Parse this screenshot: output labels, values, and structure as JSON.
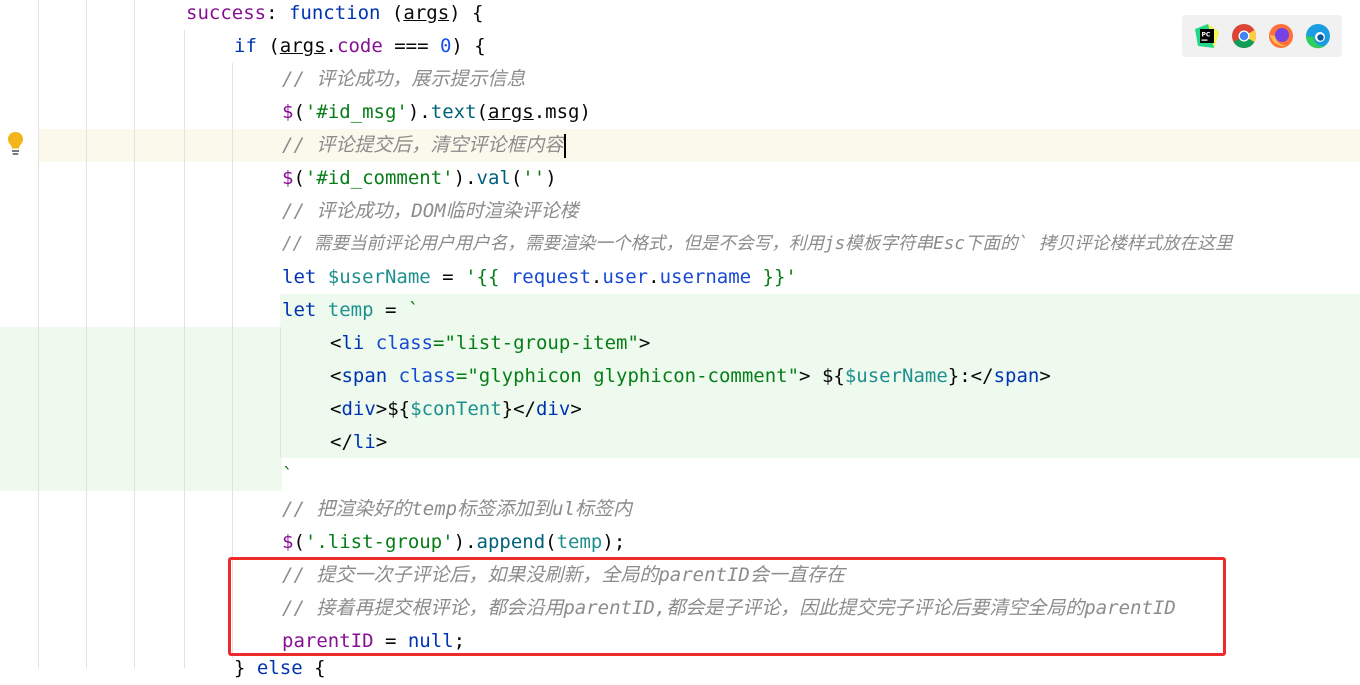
{
  "code": {
    "l1": {
      "a": "success",
      "b": ": ",
      "c": "function",
      "d": " (",
      "e": "args",
      "f": ") {"
    },
    "l2": {
      "a": "if",
      "b": " (",
      "c": "args",
      "d": ".",
      "e": "code",
      "f": " === ",
      "g": "0",
      "h": ") {"
    },
    "l3": "// 评论成功，展示提示信息",
    "l4": {
      "a": "$",
      "b": "(",
      "c": "'#id_msg'",
      "d": ").",
      "e": "text",
      "f": "(",
      "g": "args",
      "h": ".msg)"
    },
    "l5": "// 评论提交后，清空评论框内容",
    "l6": {
      "a": "$",
      "b": "(",
      "c": "'#id_comment'",
      "d": ").",
      "e": "val",
      "f": "(",
      "g": "''",
      "h": ")"
    },
    "l7": "// 评论成功，DOM临时渲染评论楼",
    "l8": "// 需要当前评论用户用户名，需要渲染一个格式，但是不会写，利用js模板字符串Esc下面的` 拷贝评论楼样式放在这里",
    "l9": {
      "a": "let",
      "b": " ",
      "c": "$userName",
      "d": " = ",
      "e": "'{{ ",
      "f": "request",
      "g": ".",
      "h": "user",
      "i": ".",
      "j": "username",
      "k": " }}'"
    },
    "l10": {
      "a": "let",
      "b": " ",
      "c": "temp",
      "d": " = ",
      "e": "`"
    },
    "l11": {
      "a": "<",
      "b": "li",
      "c": " ",
      "d": "class",
      "e": "=\"list-group-item\"",
      "f": ">"
    },
    "l12": {
      "a": "<",
      "b": "span",
      "c": " ",
      "d": "class",
      "e": "=\"glyphicon glyphicon-comment\"",
      "f": "> ",
      "g": "${",
      "h": "$userName",
      "i": "}",
      "j": ":</",
      "k": "span",
      "l": ">"
    },
    "l13": {
      "a": "<",
      "b": "div",
      "c": ">",
      "d": "${",
      "e": "$conTent",
      "f": "}",
      "g": "</",
      "h": "div",
      "i": ">"
    },
    "l14": {
      "a": "</",
      "b": "li",
      "c": ">"
    },
    "l15": "`",
    "l16": "// 把渲染好的temp标签添加到ul标签内",
    "l17": {
      "a": "$",
      "b": "(",
      "c": "'.list-group'",
      "d": ").",
      "e": "append",
      "f": "(",
      "g": "temp",
      "h": ");"
    },
    "l18": "// 提交一次子评论后，如果没刷新，全局的parentID会一直存在",
    "l19": "// 接着再提交根评论，都会沿用parentID,都会是子评论，因此提交完子评论后要清空全局的parentID",
    "l20": {
      "a": "parentID",
      "b": " = ",
      "c": "null",
      "d": ";"
    },
    "l21": {
      "a": "} ",
      "b": "else",
      "c": " {"
    }
  },
  "browsers": [
    "pycharm-icon",
    "chrome-icon",
    "firefox-icon",
    "edge-icon"
  ],
  "colors": {
    "highlight_box": "#ee2b2b",
    "comment": "#8c8c8c",
    "keyword": "#0033b3"
  }
}
